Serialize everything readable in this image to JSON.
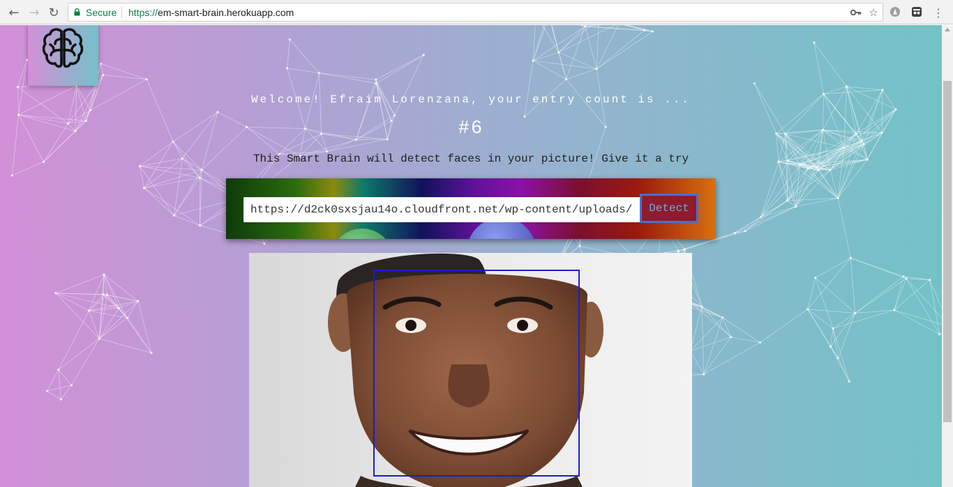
{
  "browser": {
    "secure_label": "Secure",
    "url_scheme": "https://",
    "url_host": "em-smart-brain.herokuapp.com",
    "icons": [
      "back-icon",
      "forward-icon",
      "reload-icon",
      "lock-icon",
      "key-icon",
      "star-icon",
      "extension-icon",
      "incognito-icon",
      "menu-icon"
    ]
  },
  "page": {
    "welcome_text": "Welcome! Efraim Lorenzana, your entry count is ...",
    "entry_count": "#6",
    "instruction": "This Smart Brain will detect faces in your picture! Give it a try",
    "image_url_value": "https://d2ck0sxsjau14o.cloudfront.net/wp-content/uploads/",
    "detect_label": "Detect",
    "logo_icon": "brain-icon",
    "face_box_color": "#1b1bd6"
  },
  "colors": {
    "gradient_left": "#d28fd7",
    "gradient_right": "#72c2c7",
    "secure_green": "#0b8043"
  }
}
